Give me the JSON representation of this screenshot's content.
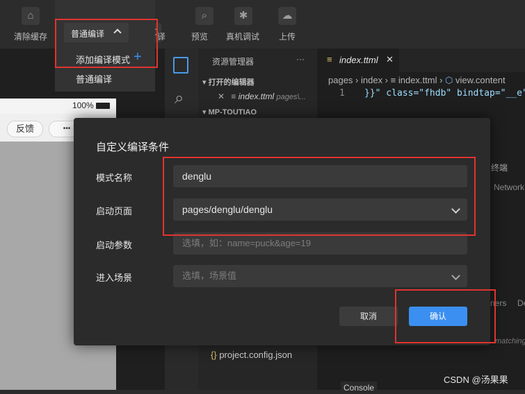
{
  "toolbar": {
    "clear_cache": "清除缓存",
    "compile_mode": "普通编译",
    "compile_suffix": "译",
    "preview": "预览",
    "real_device_debug": "真机调试",
    "upload": "上传"
  },
  "compile_menu": {
    "add_mode": "添加编译模式",
    "add_icon": "+",
    "normal": "普通编译"
  },
  "simulator": {
    "battery": "100%",
    "feedback": "反馈",
    "more": "•••"
  },
  "explorer": {
    "title": "资源管理器",
    "more": "···",
    "open_editors": "打开的编辑器",
    "open_file": "index.ttml",
    "open_file_path": "pages\\...",
    "project_root": "MP-TOUTIAO",
    "config_file": "project.config.json"
  },
  "editor": {
    "tab_name": "index.ttml",
    "breadcrumb": [
      "pages",
      "index",
      "index.ttml",
      "view.content"
    ],
    "line_number": "1",
    "code_line": "}}\" class=\"fhdb\" bindtap=\"__e\"",
    "side_terminal": "终端",
    "side_network": "Network",
    "side_ners": "ners",
    "side_de": "De",
    "side_matching": "matching",
    "console_tab": "Console"
  },
  "dialog": {
    "title": "自定义编译条件",
    "mode_name_label": "模式名称",
    "mode_name_value": "denglu",
    "start_page_label": "启动页面",
    "start_page_value": "pages/denglu/denglu",
    "start_params_label": "启动参数",
    "start_params_placeholder": "选填，如：name=puck&age=19",
    "scene_label": "进入场景",
    "scene_placeholder": "选填，场景值",
    "cancel": "取消",
    "confirm": "确认"
  },
  "watermark": "CSDN @汤果果",
  "colors": {
    "primary": "#3b8ff0",
    "highlight": "#e0342f"
  }
}
